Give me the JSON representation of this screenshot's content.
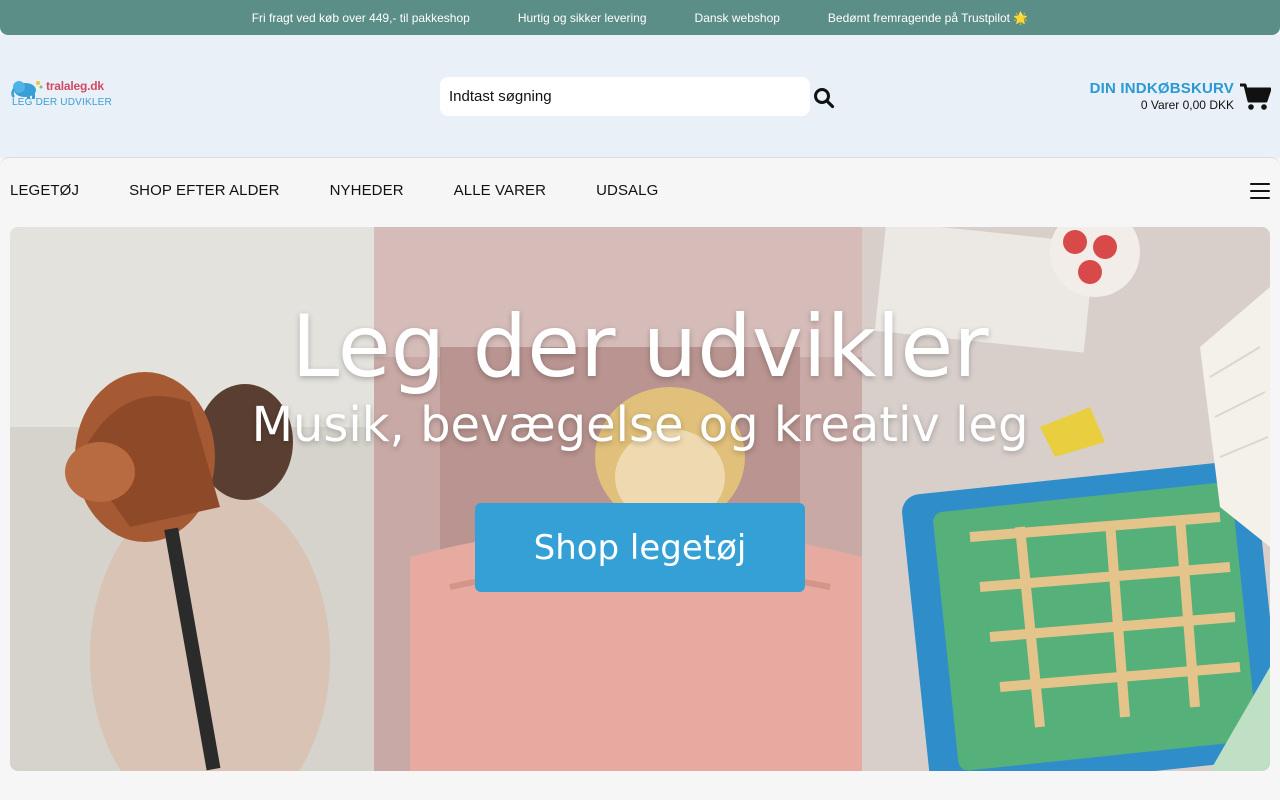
{
  "topbar": {
    "items": [
      "Fri fragt ved køb over 449,- til pakkeshop",
      "Hurtig og sikker levering",
      "Dansk webshop",
      "Bedømt fremragende på Trustpilot 🌟"
    ]
  },
  "header": {
    "logo": {
      "name": "tralaleg.dk",
      "tagline": "LEG DER UDVIKLER"
    },
    "search": {
      "placeholder": "Indtast søgning",
      "icon": "search-icon"
    },
    "cart": {
      "title": "DIN INDKØBSKURV",
      "summary": "0 Varer 0,00 DKK",
      "icon": "shopping-cart-icon"
    }
  },
  "nav": {
    "items": [
      "LEGETØJ",
      "SHOP EFTER ALDER",
      "NYHEDER",
      "ALLE VARER",
      "UDSALG"
    ],
    "menu_icon": "hamburger-menu-icon"
  },
  "banner": {
    "heading": "Leg der udvikler",
    "subheading": "Musik, bevægelse og kreativ leg",
    "button_label": "Shop legetøj"
  },
  "colors": {
    "topbar": "#5c8e88",
    "header_bg": "#e9f0f7",
    "accent_blue": "#2a9ad4",
    "button_blue": "#35a0d6",
    "logo_pink": "#d14a64"
  }
}
